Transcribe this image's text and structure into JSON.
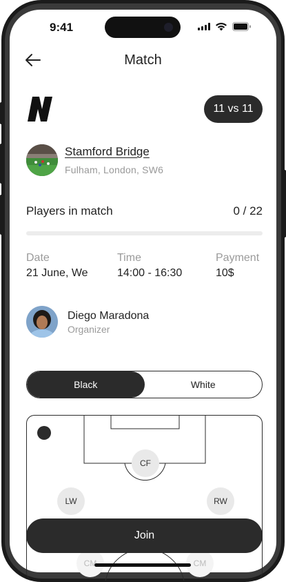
{
  "status_bar": {
    "time": "9:41"
  },
  "header": {
    "title": "Match",
    "back_icon": "arrow-left-icon"
  },
  "match": {
    "format": "11 vs 11",
    "venue": {
      "name": "Stamford Bridge",
      "address": "Fulham, London, SW6"
    },
    "players": {
      "label": "Players in match",
      "count_text": "0 / 22",
      "fill_fraction": 0
    },
    "details": [
      {
        "label": "Date",
        "value": "21 June, We"
      },
      {
        "label": "Time",
        "value": "14:00 - 16:30"
      },
      {
        "label": "Payment",
        "value": "10$"
      }
    ],
    "organizer": {
      "name": "Diego Maradona",
      "role": "Organizer"
    }
  },
  "team_toggle": {
    "options": [
      "Black",
      "White"
    ],
    "selected": "Black"
  },
  "positions": [
    "CF",
    "LW",
    "RW",
    "CM",
    "CM"
  ],
  "join_label": "Join",
  "colors": {
    "dark": "#2b2b2b",
    "muted": "#9a9a9a",
    "track": "#ececec"
  }
}
